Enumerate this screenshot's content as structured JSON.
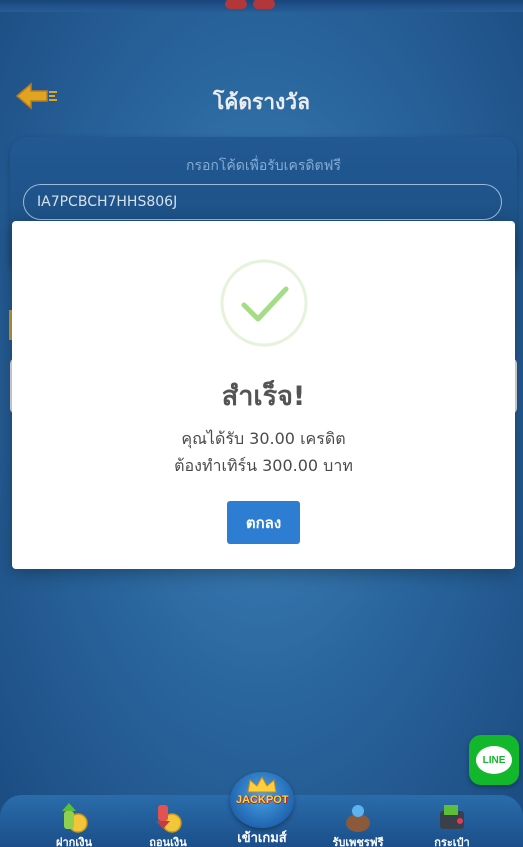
{
  "header": {
    "title": "โค้ดรางวัล",
    "back_icon": "arrow-left-icon"
  },
  "code_form": {
    "label": "กรอกโค้ดเพื่อรับเครดิตฟรี",
    "value": "IA7PCBCH7HHS806J"
  },
  "modal": {
    "icon": "check-circle-icon",
    "title": "สำเร็จ!",
    "line1": "คุณได้รับ 30.00 เครดิต",
    "line2": "ต้องทำเทิร์น 300.00 บาท",
    "ok_label": "ตกลง",
    "accent": "#a5dc86",
    "button_color": "#2d7dd2"
  },
  "line_button": {
    "label": "LINE",
    "color": "#13b72c"
  },
  "bottom_nav": {
    "deposit": "ฝากเงิน",
    "withdraw": "ถอนเงิน",
    "center_badge": "JACKPOT",
    "center_label": "เข้าเกมส์",
    "rewards": "รับเพชรฟรี",
    "wallet": "กระเป๋า"
  }
}
